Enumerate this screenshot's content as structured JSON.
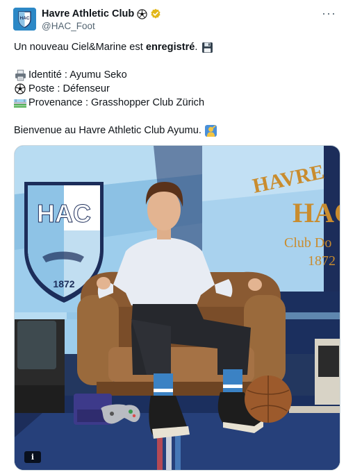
{
  "account": {
    "display_name": "Havre Athletic Club",
    "handle": "@HAC_Foot",
    "avatar_text": "HAC",
    "name_emoji_icon": "soccer-ball-icon",
    "verified_icon": "verified-badge-icon",
    "verified_color": "#e2b719"
  },
  "menu": {
    "more_label": "···"
  },
  "tweet": {
    "line1_start": "Un nouveau Ciel&Marine est ",
    "line1_bold": "enregistré",
    "line1_end": ".",
    "line1_icon": "floppy-disk-icon",
    "identity_icon": "printer-icon",
    "identity_text": "Identité : Ayumu Seko",
    "position_icon": "soccer-ball-icon",
    "position_text": "Poste : Défenseur",
    "origin_icon": "stadium-icon",
    "origin_text": "Provenance : Grasshopper Club Zürich",
    "welcome_text": "Bienvenue au Havre Athletic Club Ayumu.",
    "welcome_icon": "waving-person-icon"
  },
  "media": {
    "flag_left_text": "HAC",
    "flag_left_year": "1872",
    "flag_right_lines": [
      "HAVRE",
      "HAC",
      "Club Do",
      "1872"
    ],
    "info_label": "i",
    "colors": {
      "sky": "#8ec3e6",
      "navy": "#1c2d5a",
      "leather": "#8a5a32"
    }
  }
}
